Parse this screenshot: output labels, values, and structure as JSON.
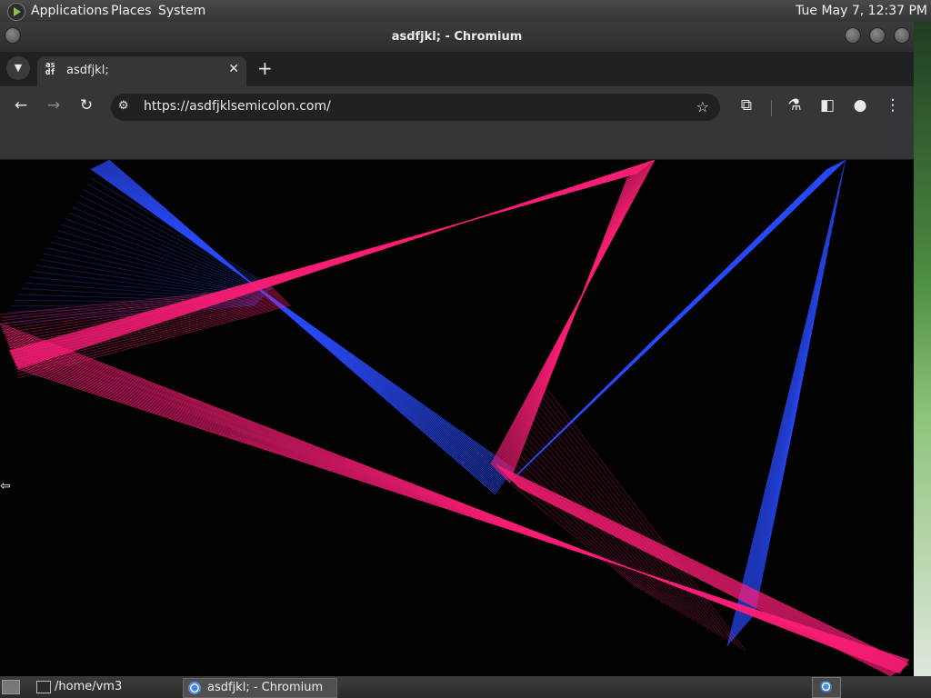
{
  "topbar": {
    "menus": [
      "Applications",
      "Places",
      "System"
    ],
    "clock": "Tue May  7, 12:37 PM"
  },
  "window": {
    "title": "asdfjkl; - Chromium"
  },
  "browser": {
    "tab": {
      "label": "asdfjkl;",
      "favicon_text": "as df"
    },
    "address": {
      "url": "https://asdfjklsemicolon.com/"
    }
  },
  "art": {
    "colors": {
      "pink": "#ff1f78",
      "blue": "#2a4cff",
      "background": "#020202"
    }
  },
  "taskbar": {
    "items": [
      {
        "label": "/home/vm3",
        "icon": "terminal-icon"
      },
      {
        "label": "asdfjkl; - Chromium",
        "icon": "chromium-icon"
      }
    ]
  }
}
